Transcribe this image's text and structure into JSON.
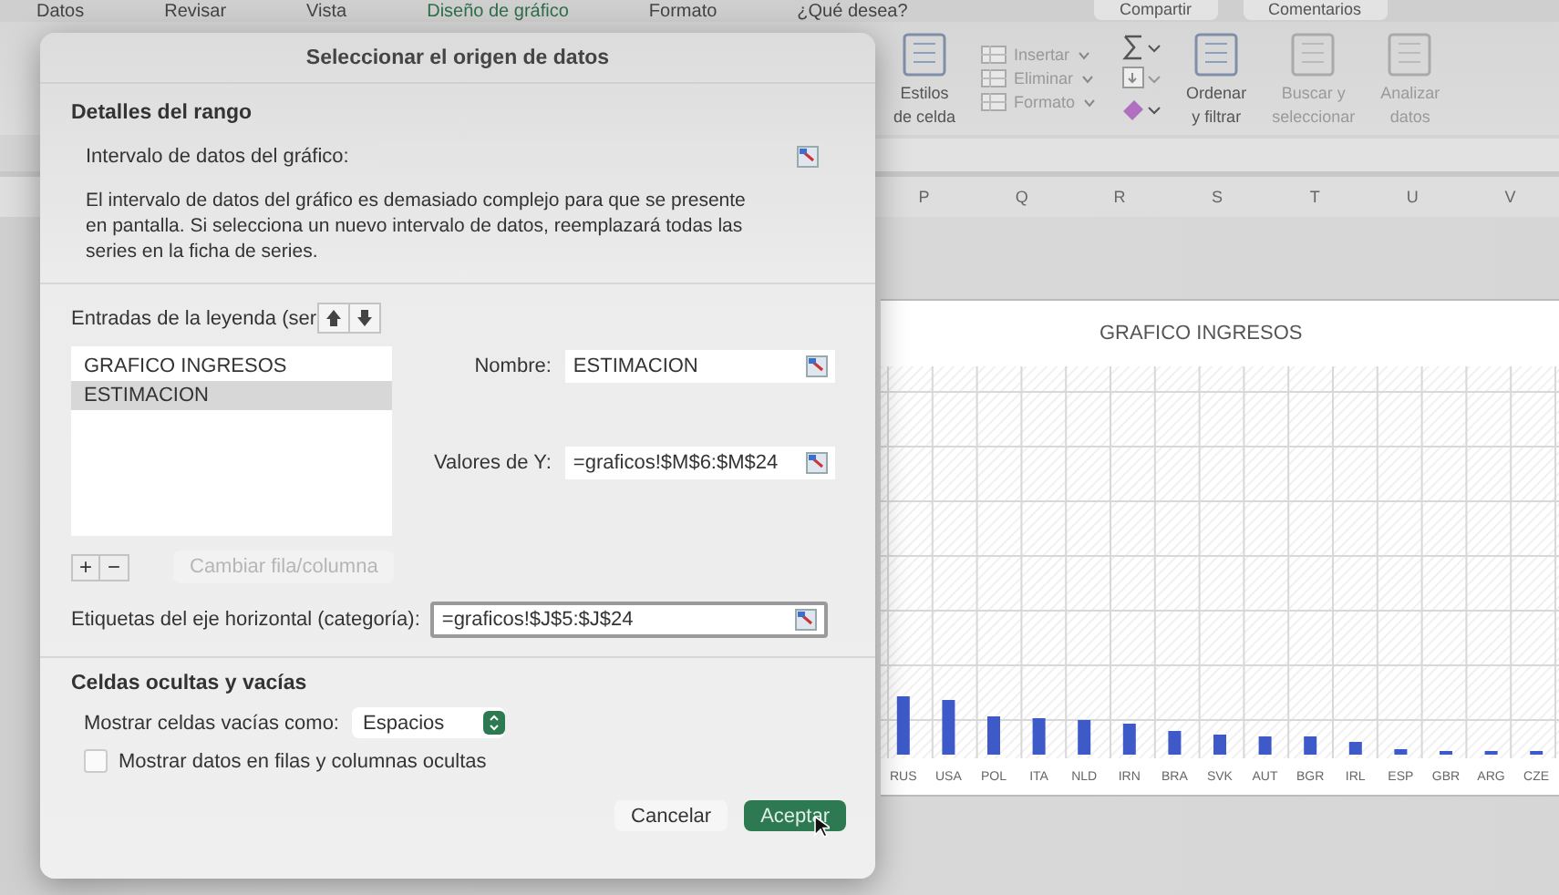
{
  "menu_bar": {
    "items": [
      {
        "label": "Datos",
        "selected": false
      },
      {
        "label": "Revisar",
        "selected": false
      },
      {
        "label": "Vista",
        "selected": false
      },
      {
        "label": "Diseño de gráfico",
        "selected": true
      },
      {
        "label": "Formato",
        "selected": false
      },
      {
        "label": "¿Qué desea?",
        "selected": false
      }
    ]
  },
  "header_buttons": [
    "Compartir",
    "Comentarios"
  ],
  "ribbon": {
    "items": [
      {
        "kind": "large",
        "lines": [
          "Estilos",
          "de celda"
        ],
        "disabled": false
      },
      {
        "kind": "stack",
        "labels": [
          "Insertar",
          "Eliminar",
          "Formato"
        ],
        "disabled": true
      },
      {
        "kind": "tools"
      },
      {
        "kind": "large",
        "lines": [
          "Ordenar",
          "y filtrar"
        ],
        "disabled": false
      },
      {
        "kind": "large",
        "lines": [
          "Buscar y",
          "seleccionar"
        ],
        "disabled": true
      },
      {
        "kind": "large",
        "lines": [
          "Analizar",
          "datos"
        ],
        "disabled": true
      }
    ]
  },
  "columns": [
    "P",
    "Q",
    "R",
    "S",
    "T",
    "U",
    "V"
  ],
  "chart": {
    "title": "GRAFICO INGRESOS",
    "category_labels": [
      "RUS",
      "USA",
      "POL",
      "ITA",
      "NLD",
      "IRN",
      "BRA",
      "SVK",
      "AUT",
      "BGR",
      "IRL",
      "ESP",
      "GBR",
      "ARG",
      "CZE"
    ]
  },
  "dialog": {
    "title": "Seleccionar el origen de datos",
    "range_details": {
      "heading": "Detalles del rango",
      "label": "Intervalo de datos del gráfico:",
      "note": "El intervalo de datos del gráfico es demasiado complejo para que se presente en pantalla. Si selecciona un nuevo intervalo de datos, reemplazará todas las series en la ficha de series."
    },
    "legend": {
      "label": "Entradas de la leyenda (ser",
      "series": [
        {
          "name": "GRAFICO INGRESOS",
          "selected": false
        },
        {
          "name": "ESTIMACION",
          "selected": true
        }
      ],
      "name_label": "Nombre:",
      "name_value": "ESTIMACION",
      "y_label": "Valores de Y:",
      "y_value": "=graficos!$M$6:$M$24",
      "add": "+",
      "remove": "−",
      "switch_button": {
        "label": "Cambiar fila/columna",
        "disabled": true
      }
    },
    "axis_labels": {
      "label": "Etiquetas del eje horizontal (categoría):",
      "value": "=graficos!$J$5:$J$24"
    },
    "hidden_cells": {
      "heading": "Celdas ocultas y vacías",
      "empty_label": "Mostrar celdas vacías como:",
      "empty_value": "Espacios",
      "show_hidden": {
        "label": "Mostrar datos en filas y columnas ocultas",
        "checked": false
      }
    },
    "buttons": [
      {
        "label": "Cancelar",
        "kind": "secondary"
      },
      {
        "label": "Aceptar",
        "kind": "default"
      }
    ]
  }
}
